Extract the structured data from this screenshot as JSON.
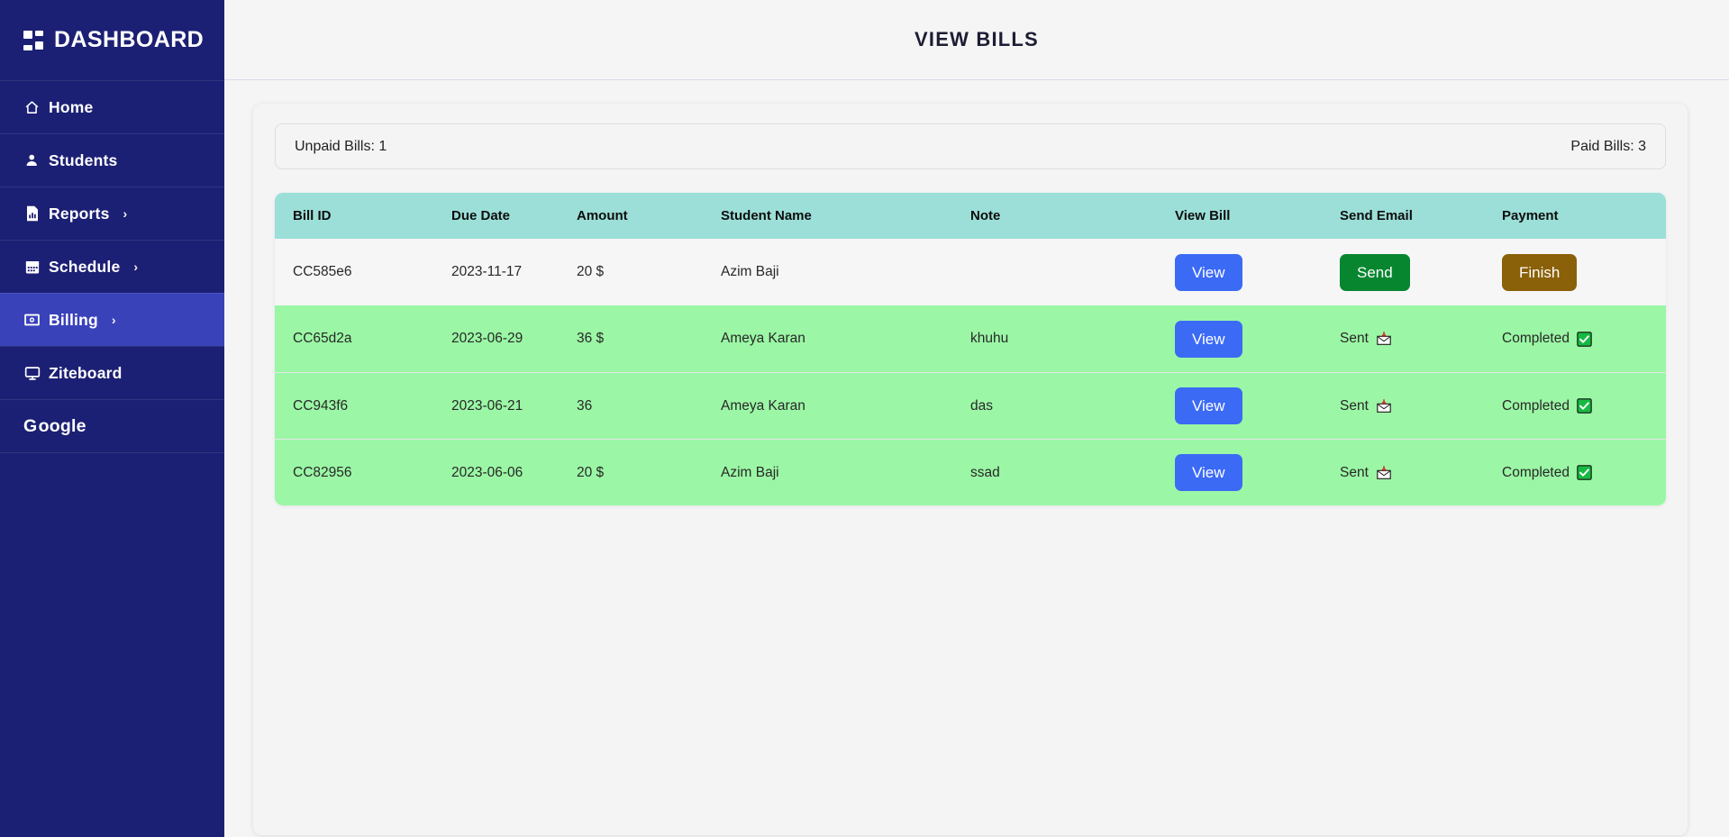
{
  "sidebar": {
    "brand": {
      "title": "DASHBOARD",
      "icon": "grid-icon"
    },
    "items": [
      {
        "label": "Home",
        "icon": "home-icon",
        "chevron": "",
        "active": false
      },
      {
        "label": "Students",
        "icon": "user-icon",
        "chevron": "",
        "active": false
      },
      {
        "label": "Reports",
        "icon": "report-document-icon",
        "chevron": "›",
        "active": false
      },
      {
        "label": "Schedule",
        "icon": "calendar-icon",
        "chevron": "›",
        "active": false
      },
      {
        "label": "Billing",
        "icon": "money-bill-icon",
        "chevron": "›",
        "active": true
      },
      {
        "label": "Ziteboard",
        "icon": "monitor-icon",
        "chevron": "",
        "active": false
      }
    ],
    "google": {
      "label_g": "G",
      "label_rest": "oogle"
    },
    "colors": {
      "background": "#1c2074",
      "active": "#3a42ba",
      "text": "#ffffff"
    }
  },
  "header": {
    "title": "VIEW BILLS"
  },
  "summary": {
    "unpaid_label": "Unpaid Bills: 1",
    "paid_label": "Paid Bills: 3"
  },
  "table": {
    "columns": [
      "Bill ID",
      "Due Date",
      "Amount",
      "Student Name",
      "Note",
      "View Bill",
      "Send Email",
      "Payment"
    ],
    "rows": [
      {
        "bill_id": "CC585e6",
        "due_date": "2023-11-17",
        "amount": "20 $",
        "student_name": "Azim Baji",
        "note": "",
        "view_label": "View",
        "email_state": "button",
        "email_label": "Send",
        "payment_state": "button",
        "payment_label": "Finish",
        "paid": false
      },
      {
        "bill_id": "CC65d2a",
        "due_date": "2023-06-29",
        "amount": "36 $",
        "student_name": "Ameya Karan",
        "note": "khuhu",
        "view_label": "View",
        "email_state": "text",
        "email_label": "Sent",
        "payment_state": "text",
        "payment_label": "Completed",
        "paid": true
      },
      {
        "bill_id": "CC943f6",
        "due_date": "2023-06-21",
        "amount": "36",
        "student_name": "Ameya Karan",
        "note": "das",
        "view_label": "View",
        "email_state": "text",
        "email_label": "Sent",
        "payment_state": "text",
        "payment_label": "Completed",
        "paid": true
      },
      {
        "bill_id": "CC82956",
        "due_date": "2023-06-06",
        "amount": "20 $",
        "student_name": "Azim Baji",
        "note": "ssad",
        "view_label": "View",
        "email_state": "text",
        "email_label": "Sent",
        "payment_state": "text",
        "payment_label": "Completed",
        "paid": true
      }
    ],
    "colors": {
      "header_background": "#9bdfd8",
      "paid_row_background": "#9bf7a5",
      "unpaid_row_background": "#f6f6f7",
      "view_button": "#3b6af5",
      "send_button": "#07862f",
      "finish_button": "#8a6008"
    },
    "icons": {
      "sent": "envelope-arrow-icon",
      "completed": "green-check-box-icon"
    }
  }
}
